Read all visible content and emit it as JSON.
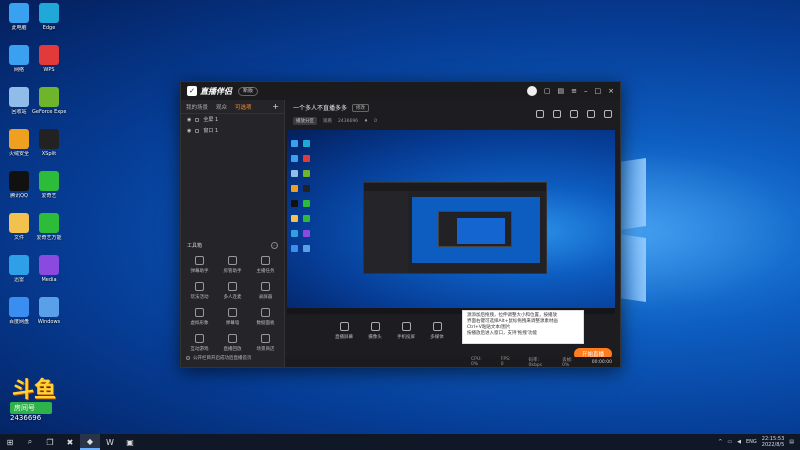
{
  "desktop": {
    "icons": [
      {
        "label": "此电脑",
        "icon": "computer-icon",
        "color": "#3aa0f0"
      },
      {
        "label": "Edge",
        "icon": "edge-icon",
        "color": "#1fa8d8"
      },
      {
        "label": "网络",
        "icon": "network-icon",
        "color": "#3aa0f0"
      },
      {
        "label": "WPS",
        "icon": "wps-icon",
        "color": "#e23a3a"
      },
      {
        "label": "回收站",
        "icon": "recycle-bin-icon",
        "color": "#8fbce8"
      },
      {
        "label": "GeForce Experience",
        "icon": "geforce-icon",
        "color": "#6fb52c"
      },
      {
        "label": "火绒安全",
        "icon": "shield-icon",
        "color": "#f0a020"
      },
      {
        "label": "XSplit",
        "icon": "xsplit-icon",
        "color": "#222"
      },
      {
        "label": "腾讯QQ",
        "icon": "qq-icon",
        "color": "#111"
      },
      {
        "label": "爱奇艺",
        "icon": "iqiyi-icon",
        "color": "#2dbb3a"
      },
      {
        "label": "文件",
        "icon": "folder-icon",
        "color": "#f2c14e"
      },
      {
        "label": "爱奇艺万能",
        "icon": "iqiyi-app-icon",
        "color": "#2dbb3a"
      },
      {
        "label": "迅雷",
        "icon": "xunlei-icon",
        "color": "#2da0e8"
      },
      {
        "label": "Media",
        "icon": "media-icon",
        "color": "#8a4ae0"
      },
      {
        "label": "百度网盘",
        "icon": "baidu-netdisk-icon",
        "color": "#3a8ef0"
      },
      {
        "label": "Windows",
        "icon": "windows-setup-icon",
        "color": "#5aa0e8"
      }
    ]
  },
  "app": {
    "brand": "直播伴侣",
    "version_tag": "新版",
    "left_tabs": [
      "我的场景",
      "观众",
      "可选项"
    ],
    "active_tab": "可选项",
    "scenes": [
      {
        "label": "全屏 1"
      },
      {
        "label": "窗口 1"
      }
    ],
    "toolbox_title": "工具箱",
    "tools": [
      {
        "label": "弹幕助手"
      },
      {
        "label": "房管助手"
      },
      {
        "label": "主播任务"
      },
      {
        "label": "玩法活动"
      },
      {
        "label": "多人连麦"
      },
      {
        "label": "录屏器"
      },
      {
        "label": "虚拟形象"
      },
      {
        "label": "弹幕墙"
      },
      {
        "label": "数据面板"
      },
      {
        "label": "互动游戏"
      },
      {
        "label": "直播回放"
      },
      {
        "label": "场景商店"
      }
    ],
    "left_footer": "公开栏目开启成功后直播首页",
    "room": {
      "title": "一个多人不直播多多",
      "edit_label": "修改",
      "category": "播放分区",
      "viewers_label": "观看",
      "viewers": "2436696",
      "likes": "0"
    },
    "tooltip_lines": [
      "源添加后拖拽，拉伸调整大小和位置，按播放",
      "界面右键可选择Alt+鼠标拖拽来调整源素材画",
      "Ctrl+V粘贴文本/图片",
      "按播放后进入窗口，支持'拖拽'功能"
    ],
    "bottom_tools": [
      {
        "label": "直播屏幕"
      },
      {
        "label": "摄像头"
      },
      {
        "label": "手机投屏"
      },
      {
        "label": "多媒体"
      }
    ],
    "live_button": "开始直播",
    "status": {
      "cpu": "CPU: 0%",
      "fps": "FPS: 0",
      "bitrate": "码率: 0kbps",
      "drop": "丢帧: 0%",
      "clock": "00:00:00"
    }
  },
  "watermark": {
    "logo": "斗鱼",
    "sub": "房间号",
    "id": "2436696"
  },
  "taskbar": {
    "items": [
      {
        "icon": "windows-start-icon",
        "glyph": "⊞"
      },
      {
        "icon": "search-icon",
        "glyph": "⌕"
      },
      {
        "icon": "task-view-icon",
        "glyph": "❐"
      },
      {
        "icon": "xsplit-taskbar-icon",
        "glyph": "✖"
      },
      {
        "icon": "douyu-taskbar-icon",
        "glyph": "◆"
      },
      {
        "icon": "wps-taskbar-icon",
        "glyph": "W"
      },
      {
        "icon": "folder-taskbar-icon",
        "glyph": "▣"
      }
    ],
    "tray": {
      "lang": "ENG",
      "time": "22:15:53",
      "date": "2022/8/5"
    }
  },
  "colors": {
    "accent": "#ff7d1e",
    "app_bg": "#222226"
  }
}
